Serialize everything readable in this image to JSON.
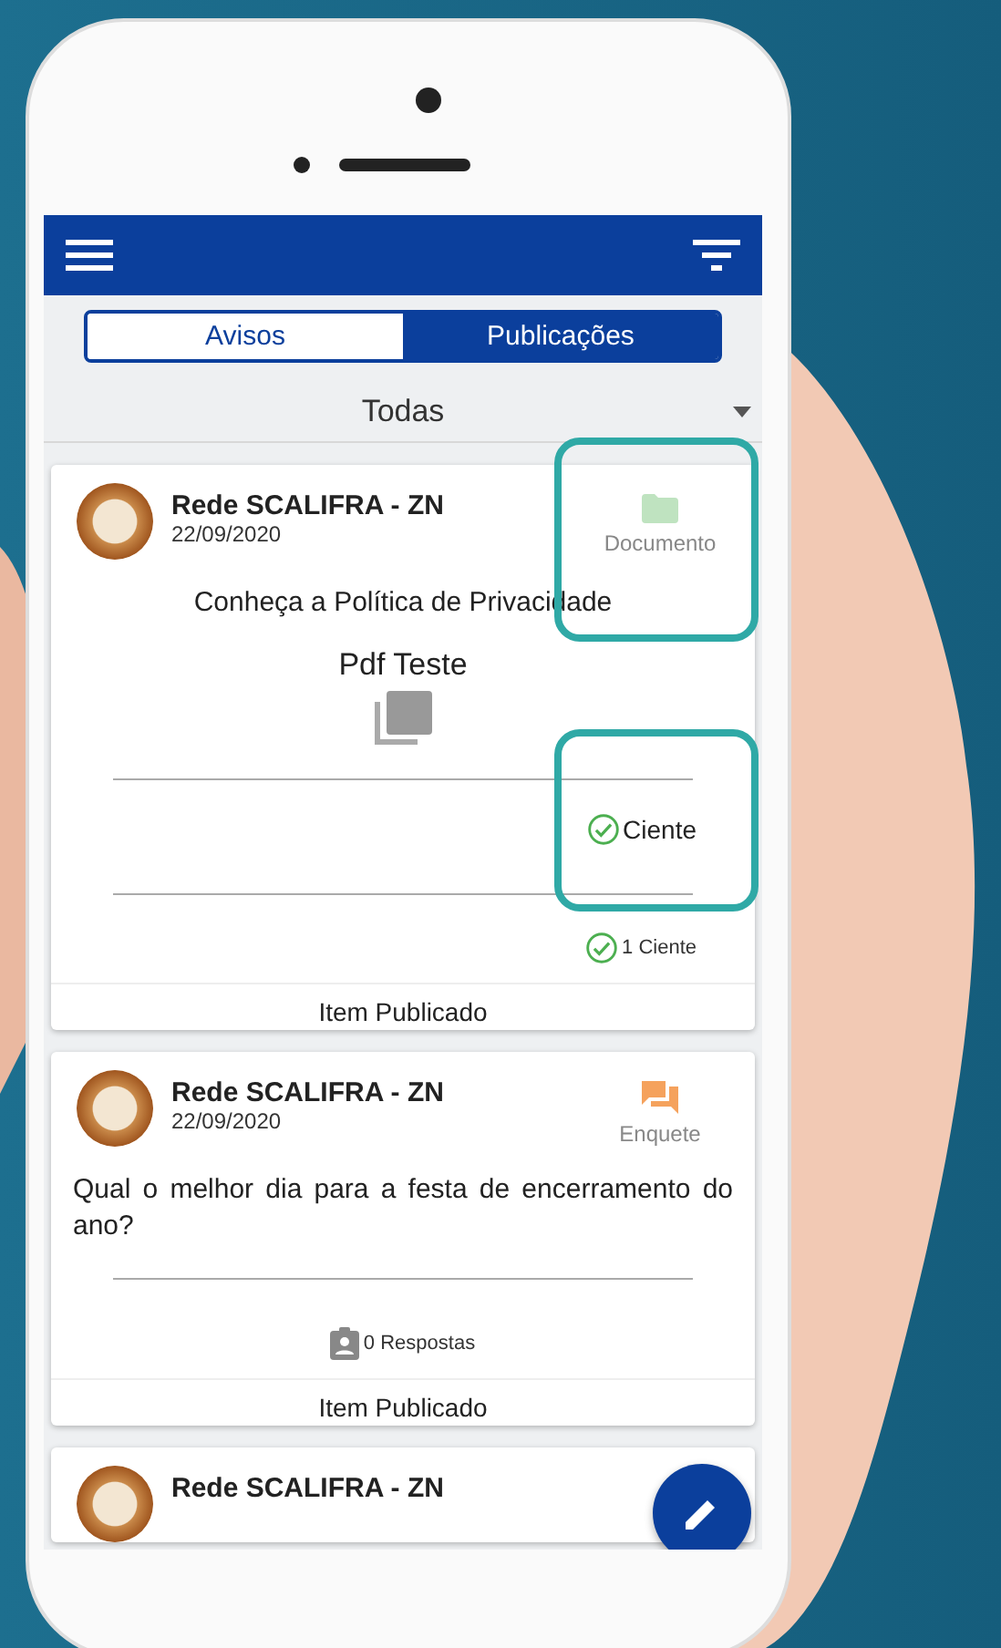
{
  "tabs": [
    {
      "label": "Avisos",
      "selected": false
    },
    {
      "label": "Publicações",
      "selected": true
    }
  ],
  "filter": {
    "value": "Todas"
  },
  "posts": [
    {
      "kind": "document",
      "author": "Rede SCALIFRA - ZN",
      "date": "22/09/2020",
      "type_label": "Documento",
      "title": "Conheça a Política de Privacidade",
      "attachment": "Pdf Teste",
      "action": "Ciente",
      "count": "1 Ciente",
      "footer": "Item Publicado"
    },
    {
      "kind": "poll",
      "author": "Rede SCALIFRA - ZN",
      "date": "22/09/2020",
      "type_label": "Enquete",
      "title": "Qual o melhor dia para a festa de encerramento do ano?",
      "count": "0 Respostas",
      "footer": "Item Publicado"
    },
    {
      "kind": "partial",
      "author": "Rede SCALIFRA - ZN"
    }
  ]
}
